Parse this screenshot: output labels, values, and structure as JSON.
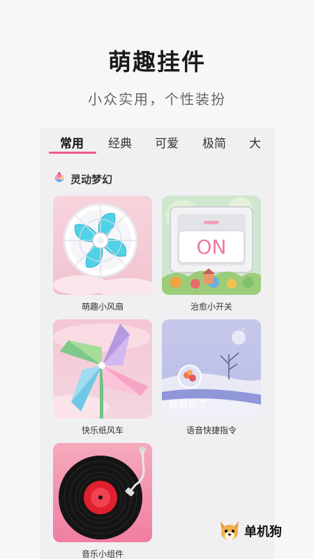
{
  "header": {
    "title": "萌趣挂件",
    "subtitle": "小众实用，个性装扮"
  },
  "tabs": [
    {
      "label": "常用",
      "active": true
    },
    {
      "label": "经典",
      "active": false
    },
    {
      "label": "可爱",
      "active": false
    },
    {
      "label": "极简",
      "active": false
    },
    {
      "label": "大",
      "active": false
    }
  ],
  "accent_color": "#f0588a",
  "section": {
    "title": "灵动梦幻",
    "icon": "ice-cream-icon"
  },
  "widgets": [
    {
      "label": "萌趣小风扇",
      "icon": "fan-icon"
    },
    {
      "label": "治愈小开关",
      "icon": "switch-icon",
      "switch_text": "ON"
    },
    {
      "label": "快乐纸风车",
      "icon": "pinwheel-icon"
    },
    {
      "label": "语音快捷指令",
      "icon": "voice-scene-icon",
      "overlay": "我想你了"
    },
    {
      "label": "音乐小组件",
      "icon": "vinyl-record-icon"
    }
  ],
  "brand": {
    "name": "单机狗",
    "icon": "dog-logo-icon"
  }
}
